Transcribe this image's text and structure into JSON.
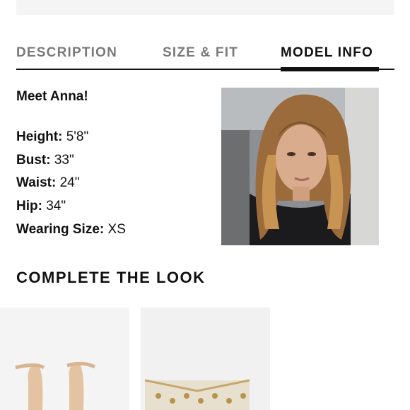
{
  "tabs": [
    {
      "label": "DESCRIPTION",
      "active": false
    },
    {
      "label": "SIZE & FIT",
      "active": false
    },
    {
      "label": "MODEL INFO",
      "active": true
    }
  ],
  "model": {
    "greeting": "Meet Anna!",
    "stats": [
      {
        "label": "Height:",
        "value": "5'8\""
      },
      {
        "label": "Bust:",
        "value": "33\""
      },
      {
        "label": "Waist:",
        "value": "24\""
      },
      {
        "label": "Hip:",
        "value": "34\""
      },
      {
        "label": "Wearing Size:",
        "value": "XS"
      }
    ]
  },
  "complete_the_look": {
    "title": "COMPLETE THE LOOK",
    "products": [
      {
        "image": "nude-strappy-heels"
      },
      {
        "image": "beaded-clutch"
      }
    ]
  },
  "colors": {
    "text": "#111111",
    "inactive_tab": "#7a7a7a",
    "top_bar": "#f5f5f5"
  }
}
